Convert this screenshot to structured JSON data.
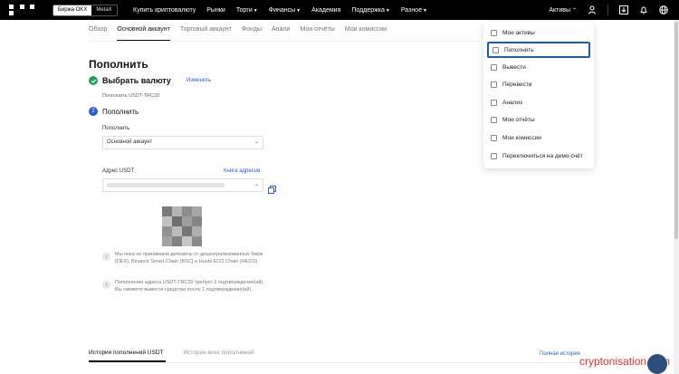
{
  "topbar": {
    "segment": [
      "Биржа OKX",
      "MetaX"
    ],
    "nav": [
      {
        "label": "Купить криптовалюту",
        "caret": false
      },
      {
        "label": "Рынки",
        "caret": false
      },
      {
        "label": "Торги",
        "caret": true
      },
      {
        "label": "Финансы",
        "caret": true
      },
      {
        "label": "Академия",
        "caret": false
      },
      {
        "label": "Поддержка",
        "caret": true
      },
      {
        "label": "Разное",
        "caret": true
      }
    ],
    "assets": "Активы"
  },
  "subnav": [
    "Обзор",
    "Основной аккаунт",
    "Торговый аккаунт",
    "Фонды",
    "Анали",
    "Мои отчёты",
    "Мои комиссии"
  ],
  "page_title": "Пополнить",
  "step1": {
    "title": "Выбрать валюту",
    "change": "Изменить",
    "sub": "Пополнить USDT-TRC20"
  },
  "step2": {
    "number": "2",
    "title": "Пополнить"
  },
  "deposit_to": {
    "label": "Пополнить",
    "value": "Основной аккаунт"
  },
  "address": {
    "label": "Адрес USDT",
    "book": "Книга адресов"
  },
  "notes": [
    "Мы пока не принимаем депозиты от децентрализованных бирж (DEX), Binance Smart Chain (BSC) и Huobi ECO Chain (HECO)",
    "Пополнение адреса USDT-TRC20 требует 1 подтверждение(ий). Вы сможете вывести средства после 1 подтверждения(ий)"
  ],
  "bottom_tabs": [
    "История пополнений USDT",
    "История всех пополнений"
  ],
  "full_history": "Полная история",
  "menu": [
    "Мои активы",
    "Пополнить",
    "Вывести",
    "Перевести",
    "Анализ",
    "Мои отчёты",
    "Мои комиссии",
    "Переключиться на демо-счёт"
  ],
  "watermark": "cryptonisation.com",
  "colors": {
    "accent": "#2b5ed0",
    "success": "#22a35a",
    "highlight": "#1f5ea8"
  }
}
